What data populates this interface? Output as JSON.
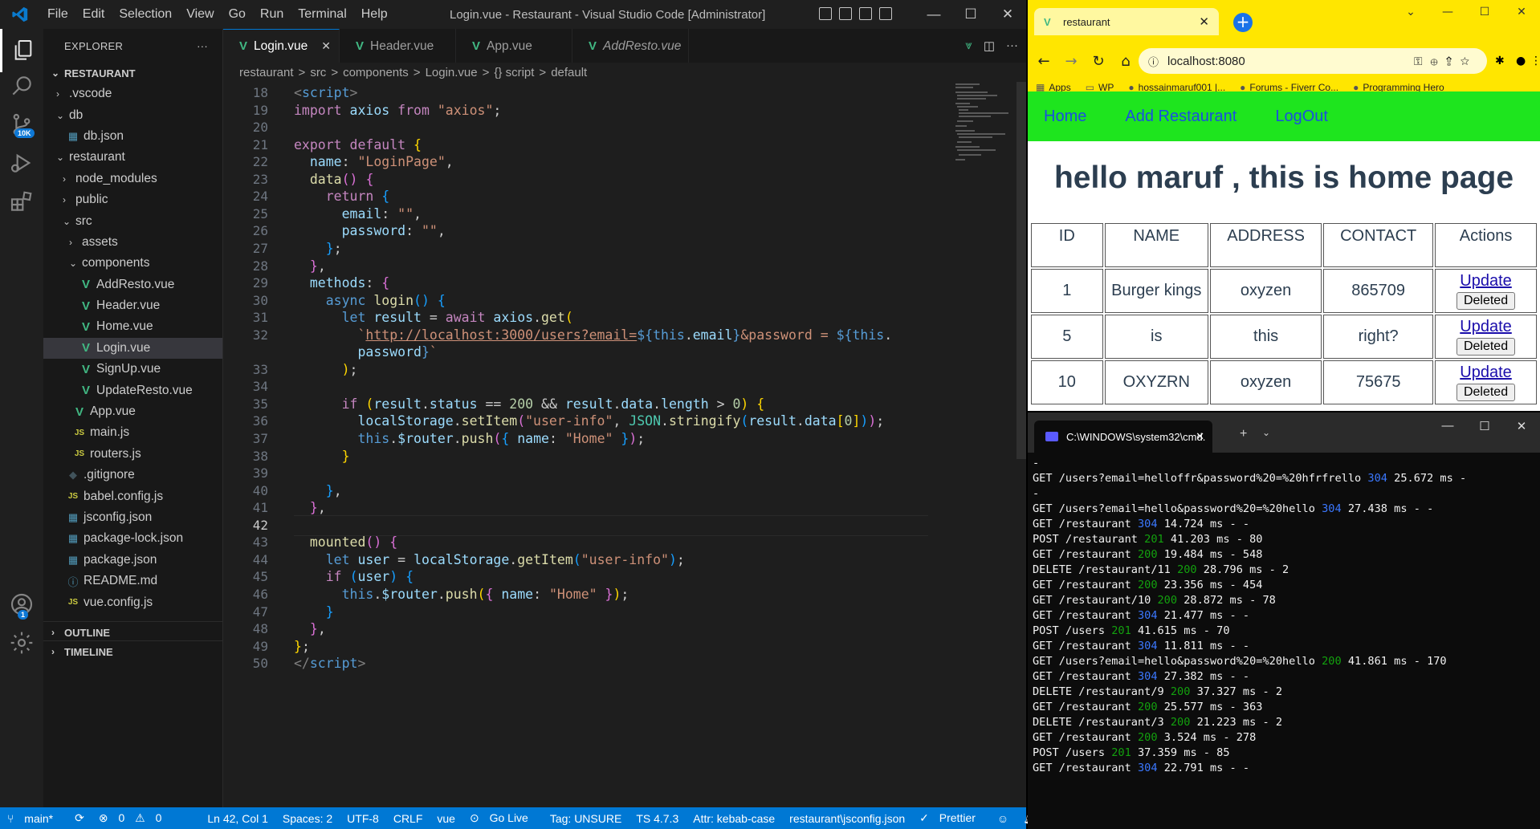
{
  "vscode": {
    "menu": [
      "File",
      "Edit",
      "Selection",
      "View",
      "Go",
      "Run",
      "Terminal",
      "Help"
    ],
    "window_title": "Login.vue - Restaurant - Visual Studio Code [Administrator]",
    "explorer_title": "EXPLORER",
    "explorer_more": "···",
    "scm_badge": "10K",
    "accounts_badge": "1",
    "root_folder": "RESTAURANT",
    "tree": [
      {
        "label": ".vscode",
        "type": "folder",
        "open": false,
        "indent": 1
      },
      {
        "label": "db",
        "type": "folder",
        "open": true,
        "indent": 1
      },
      {
        "label": "db.json",
        "type": "json",
        "indent": 2
      },
      {
        "label": "restaurant",
        "type": "folder",
        "open": true,
        "indent": 1
      },
      {
        "label": "node_modules",
        "type": "folder",
        "open": false,
        "indent": 2
      },
      {
        "label": "public",
        "type": "folder",
        "open": false,
        "indent": 2
      },
      {
        "label": "src",
        "type": "folder",
        "open": true,
        "indent": 2
      },
      {
        "label": "assets",
        "type": "folder",
        "open": false,
        "indent": 3
      },
      {
        "label": "components",
        "type": "folder",
        "open": true,
        "indent": 3
      },
      {
        "label": "AddResto.vue",
        "type": "vue",
        "indent": 4
      },
      {
        "label": "Header.vue",
        "type": "vue",
        "indent": 4
      },
      {
        "label": "Home.vue",
        "type": "vue",
        "indent": 4
      },
      {
        "label": "Login.vue",
        "type": "vue",
        "indent": 4,
        "selected": true
      },
      {
        "label": "SignUp.vue",
        "type": "vue",
        "indent": 4
      },
      {
        "label": "UpdateResto.vue",
        "type": "vue",
        "indent": 4
      },
      {
        "label": "App.vue",
        "type": "vue",
        "indent": 3
      },
      {
        "label": "main.js",
        "type": "js",
        "indent": 3
      },
      {
        "label": "routers.js",
        "type": "js",
        "indent": 3
      },
      {
        "label": ".gitignore",
        "type": "git",
        "indent": 2
      },
      {
        "label": "babel.config.js",
        "type": "js",
        "indent": 2
      },
      {
        "label": "jsconfig.json",
        "type": "json",
        "indent": 2
      },
      {
        "label": "package-lock.json",
        "type": "json",
        "indent": 2
      },
      {
        "label": "package.json",
        "type": "json",
        "indent": 2
      },
      {
        "label": "README.md",
        "type": "info",
        "indent": 2
      },
      {
        "label": "vue.config.js",
        "type": "js",
        "indent": 2
      }
    ],
    "outline_label": "OUTLINE",
    "timeline_label": "TIMELINE",
    "tabs": [
      {
        "label": "Login.vue",
        "active": true,
        "italic": false
      },
      {
        "label": "Header.vue",
        "active": false,
        "italic": false
      },
      {
        "label": "App.vue",
        "active": false,
        "italic": false
      },
      {
        "label": "AddResto.vue",
        "active": false,
        "italic": true
      }
    ],
    "breadcrumb": [
      "restaurant",
      ">",
      "src",
      ">",
      "components",
      ">",
      "Login.vue",
      ">",
      "{} script",
      ">",
      "default"
    ],
    "code_lines": [
      {
        "n": "18",
        "html": "<span class=\"t\">&lt;</span><span class=\"k2\">script</span><span class=\"t\">&gt;</span>"
      },
      {
        "n": "19",
        "html": "<span class=\"k\">import</span> <span class=\"v\">axios</span> <span class=\"k\">from</span> <span class=\"s\">\"axios\"</span>;"
      },
      {
        "n": "20",
        "html": ""
      },
      {
        "n": "21",
        "html": "<span class=\"k\">export</span> <span class=\"k\">default</span> <span class=\"b1\">{</span>"
      },
      {
        "n": "22",
        "html": "  <span class=\"v\">name</span>: <span class=\"s\">\"LoginPage\"</span>,"
      },
      {
        "n": "23",
        "html": "  <span class=\"f\">data</span><span class=\"b2\">()</span> <span class=\"b2\">{</span>"
      },
      {
        "n": "24",
        "html": "    <span class=\"k\">return</span> <span class=\"b3\">{</span>"
      },
      {
        "n": "25",
        "html": "      <span class=\"v\">email</span>: <span class=\"s\">\"\"</span>,"
      },
      {
        "n": "26",
        "html": "      <span class=\"v\">password</span>: <span class=\"s\">\"\"</span>,"
      },
      {
        "n": "27",
        "html": "    <span class=\"b3\">}</span>;"
      },
      {
        "n": "28",
        "html": "  <span class=\"b2\">}</span>,"
      },
      {
        "n": "29",
        "html": "  <span class=\"v\">methods</span>: <span class=\"b2\">{</span>"
      },
      {
        "n": "30",
        "html": "    <span class=\"k2\">async</span> <span class=\"f\">login</span><span class=\"b3\">()</span> <span class=\"b3\">{</span>"
      },
      {
        "n": "31",
        "html": "      <span class=\"k2\">let</span> <span class=\"v\">result</span> = <span class=\"k\">await</span> <span class=\"v\">axios</span>.<span class=\"f\">get</span><span class=\"b1\">(</span>"
      },
      {
        "n": "32",
        "html": "        <span class=\"s\">`<span class=\"u\">http://localhost:3000/users?email=</span></span><span class=\"k2\">${</span><span class=\"k2\">this</span>.<span class=\"v\">email</span><span class=\"k2\">}</span><span class=\"s\">&amp;password = </span><span class=\"k2\">${</span><span class=\"k2\">this</span>."
      },
      {
        "n": "",
        "html": "        <span class=\"v\">password</span><span class=\"k2\">}</span><span class=\"s\">`</span>"
      },
      {
        "n": "33",
        "html": "      <span class=\"b1\">)</span>;"
      },
      {
        "n": "34",
        "html": ""
      },
      {
        "n": "35",
        "html": "      <span class=\"k\">if</span> <span class=\"b1\">(</span><span class=\"v\">result</span>.<span class=\"v\">status</span> == <span class=\"n\">200</span> &amp;&amp; <span class=\"v\">result</span>.<span class=\"v\">data</span>.<span class=\"v\">length</span> &gt; <span class=\"n\">0</span><span class=\"b1\">)</span> <span class=\"b1\">{</span>"
      },
      {
        "n": "36",
        "html": "        <span class=\"v\">localStorage</span>.<span class=\"f\">setItem</span><span class=\"b2\">(</span><span class=\"s\">\"user-info\"</span>, <span class=\"c4\">JSON</span>.<span class=\"f\">stringify</span><span class=\"b3\">(</span><span class=\"v\">result</span>.<span class=\"v\">data</span><span class=\"b1\">[</span><span class=\"n\">0</span><span class=\"b1\">]</span><span class=\"b3\">)</span><span class=\"b2\">)</span>;"
      },
      {
        "n": "37",
        "html": "        <span class=\"k2\">this</span>.<span class=\"v\">$router</span>.<span class=\"f\">push</span><span class=\"b2\">(</span><span class=\"b3\">{</span> <span class=\"v\">name</span>: <span class=\"s\">\"Home\"</span> <span class=\"b3\">}</span><span class=\"b2\">)</span>;"
      },
      {
        "n": "38",
        "html": "      <span class=\"b1\">}</span>"
      },
      {
        "n": "39",
        "html": ""
      },
      {
        "n": "40",
        "html": "    <span class=\"b3\">}</span>,"
      },
      {
        "n": "41",
        "html": "  <span class=\"b2\">}</span>,"
      },
      {
        "n": "42",
        "html": "",
        "current": true
      },
      {
        "n": "43",
        "html": "  <span class=\"f\">mounted</span><span class=\"b2\">()</span> <span class=\"b2\">{</span>"
      },
      {
        "n": "44",
        "html": "    <span class=\"k2\">let</span> <span class=\"v\">user</span> = <span class=\"v\">localStorage</span>.<span class=\"f\">getItem</span><span class=\"b3\">(</span><span class=\"s\">\"user-info\"</span><span class=\"b3\">)</span>;"
      },
      {
        "n": "45",
        "html": "    <span class=\"k\">if</span> <span class=\"b3\">(</span><span class=\"v\">user</span><span class=\"b3\">)</span> <span class=\"b3\">{</span>"
      },
      {
        "n": "46",
        "html": "      <span class=\"k2\">this</span>.<span class=\"v\">$router</span>.<span class=\"f\">push</span><span class=\"b1\">(</span><span class=\"b2\">{</span> <span class=\"v\">name</span>: <span class=\"s\">\"Home\"</span> <span class=\"b2\">}</span><span class=\"b1\">)</span>;"
      },
      {
        "n": "47",
        "html": "    <span class=\"b3\">}</span>"
      },
      {
        "n": "48",
        "html": "  <span class=\"b2\">}</span>,"
      },
      {
        "n": "49",
        "html": "<span class=\"b1\">}</span>;"
      },
      {
        "n": "50",
        "html": "<span class=\"t\">&lt;/</span><span class=\"k2\">script</span><span class=\"t\">&gt;</span>"
      }
    ],
    "status": {
      "branch": "main*",
      "errors": "0",
      "warnings": "0",
      "position": "Ln 42, Col 1",
      "spaces": "Spaces: 2",
      "encoding": "UTF-8",
      "eol": "CRLF",
      "language": "vue",
      "golive": "Go Live",
      "tag": "Tag: UNSURE",
      "ts": "TS 4.7.3",
      "attr": "Attr: kebab-case",
      "config": "restaurant\\jsconfig.json",
      "prettier": "Prettier"
    }
  },
  "chrome": {
    "tab_title": "restaurant",
    "url": "localhost:8080",
    "bookmarks": [
      "Apps",
      "WP",
      "hossainmaruf001 |...",
      "Forums - Fiverr Co...",
      "Programming Hero"
    ],
    "nav": [
      "Home",
      "Add Restaurant",
      "LogOut"
    ],
    "heading": "hello maruf , this is home page",
    "table_headers": [
      "ID",
      "NAME",
      "ADDRESS",
      "CONTACT",
      "Actions"
    ],
    "rows": [
      {
        "id": "1",
        "name": "Burger kings",
        "address": "oxyzen",
        "contact": "865709"
      },
      {
        "id": "5",
        "name": "is",
        "address": "this",
        "contact": "right?"
      },
      {
        "id": "10",
        "name": "OXYZRN",
        "address": "oxyzen",
        "contact": "75675"
      }
    ],
    "update_label": "Update",
    "delete_label": "Deleted",
    "accent": "#ffe600",
    "nav_bg": "#1ee51e"
  },
  "terminal": {
    "tab_title": "C:\\WINDOWS\\system32\\cmd.",
    "lines": [
      {
        "pre": "-",
        "code": "",
        "post": "",
        "color": ""
      },
      {
        "pre": "GET /users?email=helloffr&password%20=%20hfrfrello ",
        "code": "304",
        "post": " 25.672 ms -",
        "color": "st3"
      },
      {
        "pre": "-",
        "code": "",
        "post": "",
        "color": ""
      },
      {
        "pre": "GET /users?email=hello&password%20=%20hello ",
        "code": "304",
        "post": " 27.438 ms - -",
        "color": "st3"
      },
      {
        "pre": "GET /restaurant ",
        "code": "304",
        "post": " 14.724 ms - -",
        "color": "st3"
      },
      {
        "pre": "POST /restaurant ",
        "code": "201",
        "post": " 41.203 ms - 80",
        "color": "st2"
      },
      {
        "pre": "GET /restaurant ",
        "code": "200",
        "post": " 19.484 ms - 548",
        "color": "st2"
      },
      {
        "pre": "DELETE /restaurant/11 ",
        "code": "200",
        "post": " 28.796 ms - 2",
        "color": "st2"
      },
      {
        "pre": "GET /restaurant ",
        "code": "200",
        "post": " 23.356 ms - 454",
        "color": "st2"
      },
      {
        "pre": "GET /restaurant/10 ",
        "code": "200",
        "post": " 28.872 ms - 78",
        "color": "st2"
      },
      {
        "pre": "GET /restaurant ",
        "code": "304",
        "post": " 21.477 ms - -",
        "color": "st3"
      },
      {
        "pre": "POST /users ",
        "code": "201",
        "post": " 41.615 ms - 70",
        "color": "st2"
      },
      {
        "pre": "GET /restaurant ",
        "code": "304",
        "post": " 11.811 ms - -",
        "color": "st3"
      },
      {
        "pre": "GET /users?email=hello&password%20=%20hello ",
        "code": "200",
        "post": " 41.861 ms - 170",
        "color": "st2"
      },
      {
        "pre": "GET /restaurant ",
        "code": "304",
        "post": " 27.382 ms - -",
        "color": "st3"
      },
      {
        "pre": "DELETE /restaurant/9 ",
        "code": "200",
        "post": " 37.327 ms - 2",
        "color": "st2"
      },
      {
        "pre": "GET /restaurant ",
        "code": "200",
        "post": " 25.577 ms - 363",
        "color": "st2"
      },
      {
        "pre": "DELETE /restaurant/3 ",
        "code": "200",
        "post": " 21.223 ms - 2",
        "color": "st2"
      },
      {
        "pre": "GET /restaurant ",
        "code": "200",
        "post": " 3.524 ms - 278",
        "color": "st2"
      },
      {
        "pre": "POST /users ",
        "code": "201",
        "post": " 37.359 ms - 85",
        "color": "st2"
      },
      {
        "pre": "GET /restaurant ",
        "code": "304",
        "post": " 22.791 ms - -",
        "color": "st3"
      }
    ]
  }
}
